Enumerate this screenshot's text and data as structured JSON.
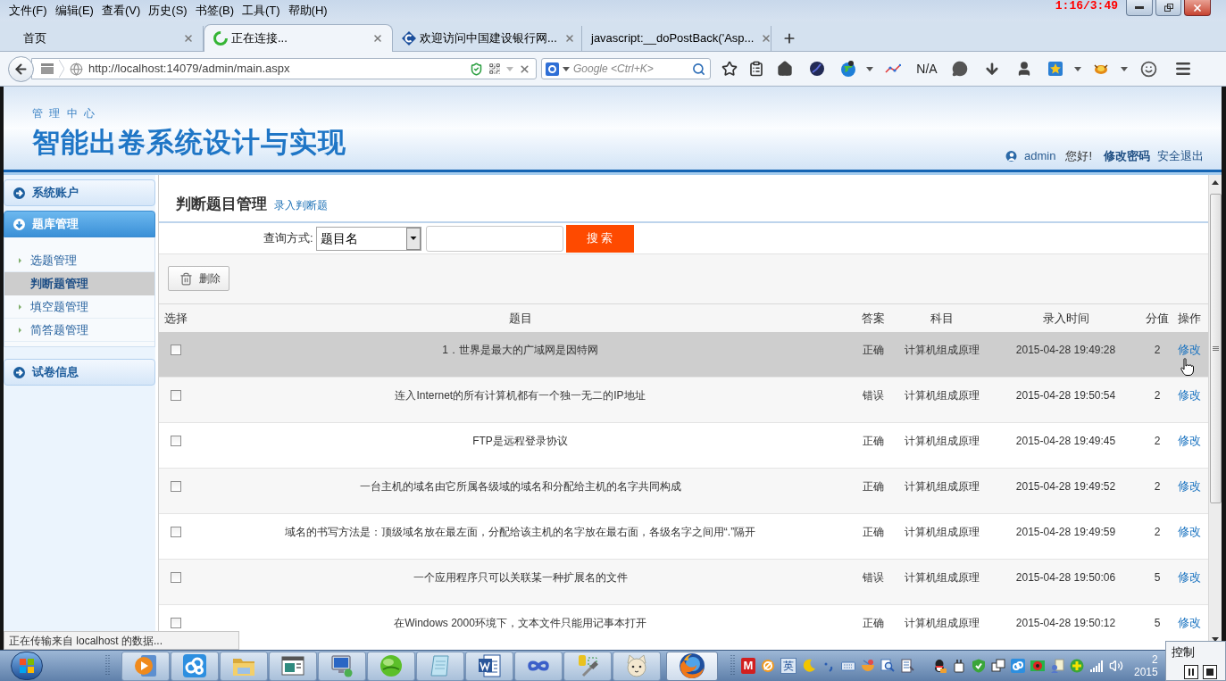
{
  "recording_timer": "1:16/3:49",
  "menu": [
    "文件(F)",
    "编辑(E)",
    "查看(V)",
    "历史(S)",
    "书签(B)",
    "工具(T)",
    "帮助(H)"
  ],
  "tabs": [
    {
      "title": "首页",
      "kind": "plain",
      "selected": false
    },
    {
      "title": "正在连接...",
      "kind": "loading",
      "selected": true
    },
    {
      "title": "欢迎访问中国建设银行网...",
      "kind": "bank",
      "selected": false
    },
    {
      "title": "javascript:__doPostBack('Asp...",
      "kind": "plain",
      "selected": false
    }
  ],
  "address_bar": {
    "url": "http://localhost:14079/admin/main.aspx"
  },
  "search_bar": {
    "placeholder": "Google <Ctrl+K>"
  },
  "toolbar": {
    "status": "N/A"
  },
  "header": {
    "subtitle": "管 理 中 心",
    "title": "智能出卷系统设计与实现",
    "user": "admin",
    "greeting": "您好!",
    "change_password": "修改密码",
    "logout": "安全退出"
  },
  "sidebar": {
    "sections": [
      {
        "title": "系统账户",
        "expanded": false
      },
      {
        "title": "题库管理",
        "expanded": true,
        "children": [
          {
            "label": "选题管理",
            "selected": false
          },
          {
            "label": "判断题管理",
            "selected": true
          },
          {
            "label": "填空题管理",
            "selected": false
          },
          {
            "label": "简答题管理",
            "selected": false
          }
        ]
      },
      {
        "title": "试卷信息",
        "expanded": false
      }
    ]
  },
  "content": {
    "title": "判断题目管理",
    "add_link": "录入判断题",
    "search": {
      "label": "查询方式:",
      "field": "题目名",
      "button": "搜 索"
    },
    "delete_button": "删除"
  },
  "table": {
    "columns": [
      "选择",
      "题目",
      "答案",
      "科目",
      "录入时间",
      "分值",
      "操作"
    ],
    "rows": [
      {
        "checked": false,
        "highlighted": true,
        "question": "1．世界是最大的广域网是因特网",
        "answer": "正确",
        "subject": "计算机组成原理",
        "time": "2015-04-28 19:49:28",
        "score": "2",
        "action": "修改"
      },
      {
        "checked": false,
        "highlighted": false,
        "question": "连入Internet的所有计算机都有一个独一无二的IP地址",
        "answer": "错误",
        "subject": "计算机组成原理",
        "time": "2015-04-28 19:50:54",
        "score": "2",
        "action": "修改"
      },
      {
        "checked": false,
        "highlighted": false,
        "question": "FTP是远程登录协议",
        "answer": "正确",
        "subject": "计算机组成原理",
        "time": "2015-04-28 19:49:45",
        "score": "2",
        "action": "修改"
      },
      {
        "checked": false,
        "highlighted": false,
        "question": "一台主机的域名由它所属各级域的域名和分配给主机的名字共同构成",
        "answer": "正确",
        "subject": "计算机组成原理",
        "time": "2015-04-28 19:49:52",
        "score": "2",
        "action": "修改"
      },
      {
        "checked": false,
        "highlighted": false,
        "question": "域名的书写方法是：顶级域名放在最左面，分配给该主机的名字放在最右面，各级名字之间用“.”隔开",
        "answer": "正确",
        "subject": "计算机组成原理",
        "time": "2015-04-28 19:49:59",
        "score": "2",
        "action": "修改"
      },
      {
        "checked": false,
        "highlighted": false,
        "question": "一个应用程序只可以关联某一种扩展名的文件",
        "answer": "错误",
        "subject": "计算机组成原理",
        "time": "2015-04-28 19:50:06",
        "score": "5",
        "action": "修改"
      },
      {
        "checked": false,
        "highlighted": false,
        "question": "在Windows 2000环境下，文本文件只能用记事本打开",
        "answer": "正确",
        "subject": "计算机组成原理",
        "time": "2015-04-28 19:50:12",
        "score": "5",
        "action": "修改"
      }
    ]
  },
  "status_text": "正在传输来自 localhost 的数据...",
  "taskbar": {
    "apps": [
      {
        "kind": "media",
        "selected": false
      },
      {
        "kind": "cloud",
        "selected": false
      },
      {
        "kind": "folder",
        "selected": false
      },
      {
        "kind": "window",
        "selected": false
      },
      {
        "kind": "computer",
        "selected": false
      },
      {
        "kind": "ball",
        "selected": false
      },
      {
        "kind": "notepad",
        "selected": false
      },
      {
        "kind": "document",
        "selected": false
      },
      {
        "kind": "infinity",
        "selected": false
      },
      {
        "kind": "tools",
        "selected": false
      },
      {
        "kind": "cat",
        "selected": false
      },
      {
        "kind": "browser",
        "selected": true
      }
    ],
    "tray_badge": "M",
    "ime": "英",
    "clock_time": "2",
    "clock_date": "2015",
    "popup_title": "控制"
  }
}
